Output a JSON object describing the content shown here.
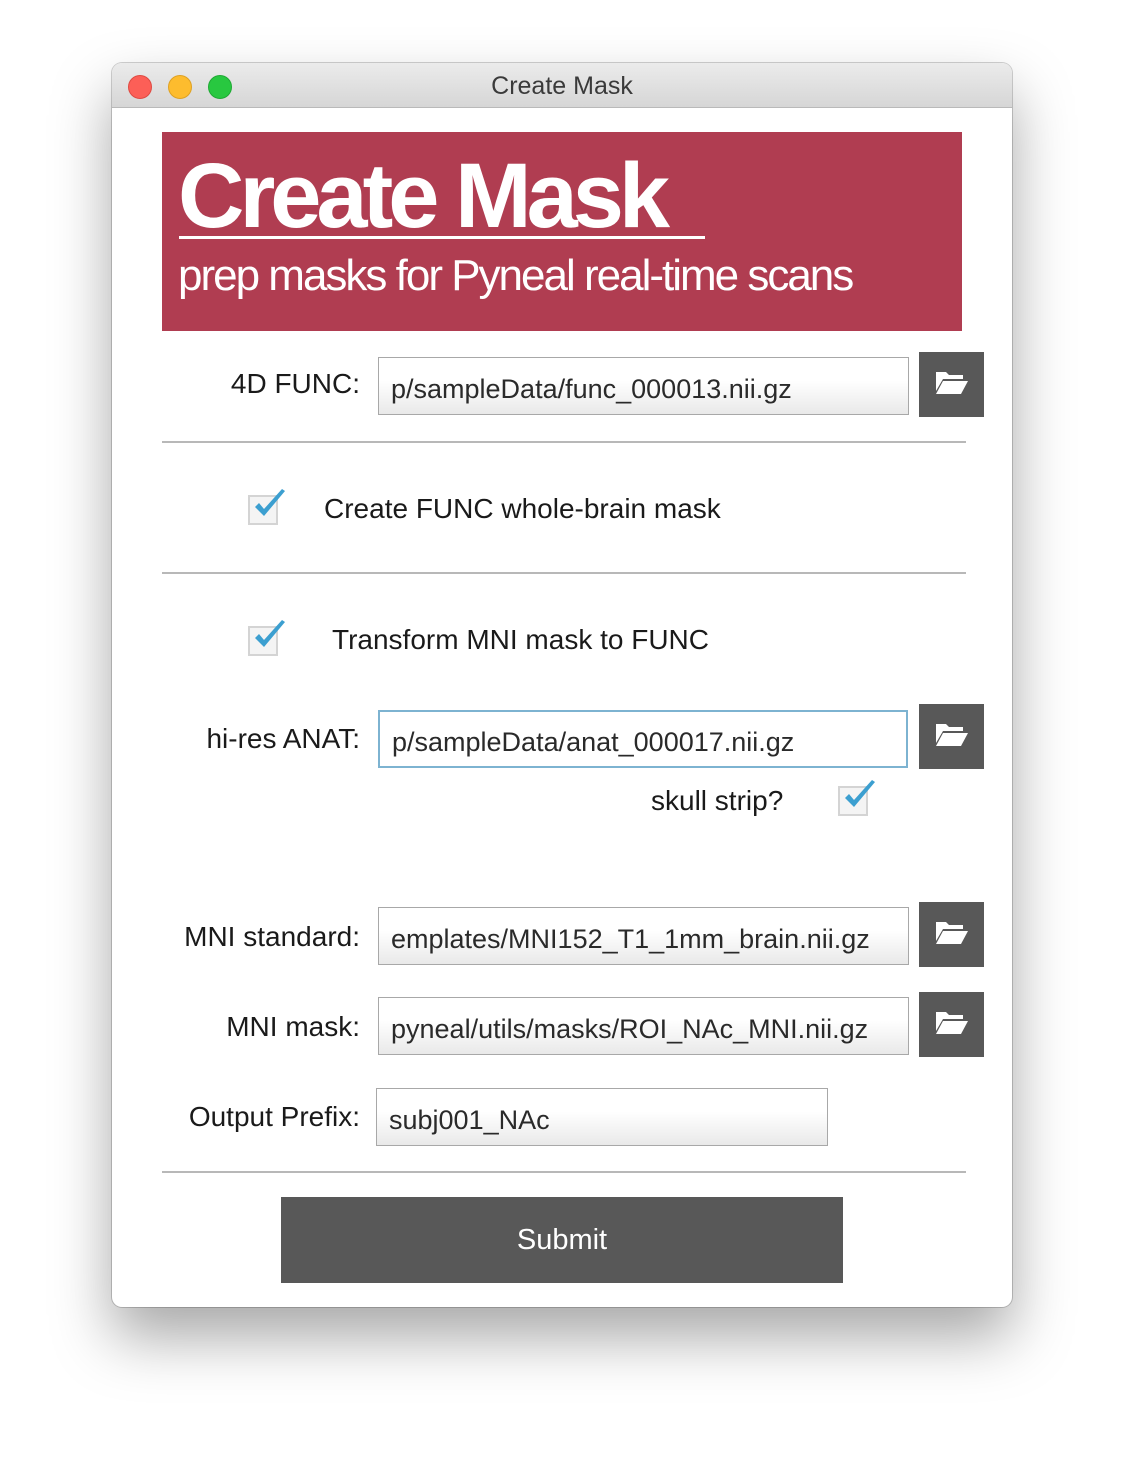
{
  "window": {
    "title": "Create Mask"
  },
  "banner": {
    "title": "Create Mask",
    "subtitle": "prep masks for Pyneal real-time scans",
    "background_color": "#b03d51"
  },
  "func": {
    "label": "4D FUNC:",
    "value": "p/sampleData/func_000013.nii.gz",
    "browse_icon": "folder-open-icon"
  },
  "create_func_mask": {
    "label": "Create FUNC whole-brain mask",
    "checked": true
  },
  "transform_mni": {
    "label": "Transform MNI mask to FUNC",
    "checked": true
  },
  "anat": {
    "label": "hi-res ANAT:",
    "value": "p/sampleData/anat_000017.nii.gz",
    "browse_icon": "folder-open-icon"
  },
  "skull_strip": {
    "label": "skull strip?",
    "checked": true
  },
  "mni_standard": {
    "label": "MNI standard:",
    "value": "emplates/MNI152_T1_1mm_brain.nii.gz",
    "browse_icon": "folder-open-icon"
  },
  "mni_mask": {
    "label": "MNI mask:",
    "value": "pyneal/utils/masks/ROI_NAc_MNI.nii.gz",
    "browse_icon": "folder-open-icon"
  },
  "output_prefix": {
    "label": "Output Prefix:",
    "value": "subj001_NAc"
  },
  "submit": {
    "label": "Submit",
    "color": "#585858"
  },
  "colors": {
    "checkmark": "#3c9fd0",
    "button_dark": "#585858"
  }
}
